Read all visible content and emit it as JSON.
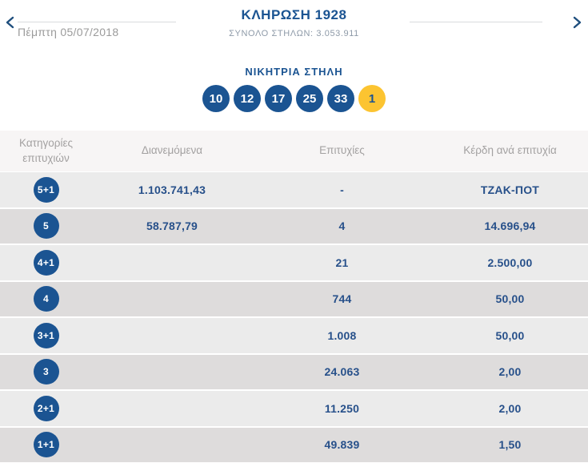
{
  "header": {
    "title": "ΚΛΗΡΩΣΗ 1928",
    "total_columns_label": "ΣΥΝΟΛΟ ΣΤΗΛΩΝ: 3.053.911",
    "draw_date": "Πέμπτη 05/07/2018",
    "prev_icon": "chevron-left",
    "next_icon": "chevron-right"
  },
  "winning_column": {
    "heading": "ΝΙΚΗΤΡΙΑ ΣΤΗΛΗ",
    "numbers": [
      "10",
      "12",
      "17",
      "25",
      "33"
    ],
    "bonus_number": "1"
  },
  "results_table": {
    "columns": [
      "Κατηγορίες επιτυχιών",
      "Διανεμόμενα",
      "Επιτυχίες",
      "Κέρδη ανά επιτυχία"
    ],
    "rows": [
      {
        "category": "5+1",
        "distributed": "1.103.741,43",
        "wins": "-",
        "prize": "ΤΖΑΚ-ΠΟΤ"
      },
      {
        "category": "5",
        "distributed": "58.787,79",
        "wins": "4",
        "prize": "14.696,94"
      },
      {
        "category": "4+1",
        "distributed": "",
        "wins": "21",
        "prize": "2.500,00"
      },
      {
        "category": "4",
        "distributed": "",
        "wins": "744",
        "prize": "50,00"
      },
      {
        "category": "3+1",
        "distributed": "",
        "wins": "1.008",
        "prize": "50,00"
      },
      {
        "category": "3",
        "distributed": "",
        "wins": "24.063",
        "prize": "2,00"
      },
      {
        "category": "2+1",
        "distributed": "",
        "wins": "11.250",
        "prize": "2,00"
      },
      {
        "category": "1+1",
        "distributed": "",
        "wins": "49.839",
        "prize": "1,50"
      }
    ]
  },
  "colors": {
    "primary_blue": "#1b5492",
    "bonus_yellow": "#fcc431",
    "row_light": "#ebebeb",
    "row_dark": "#dedcdc",
    "table_header_bg": "#f7f5f5",
    "muted_text": "#9b9b9b"
  }
}
